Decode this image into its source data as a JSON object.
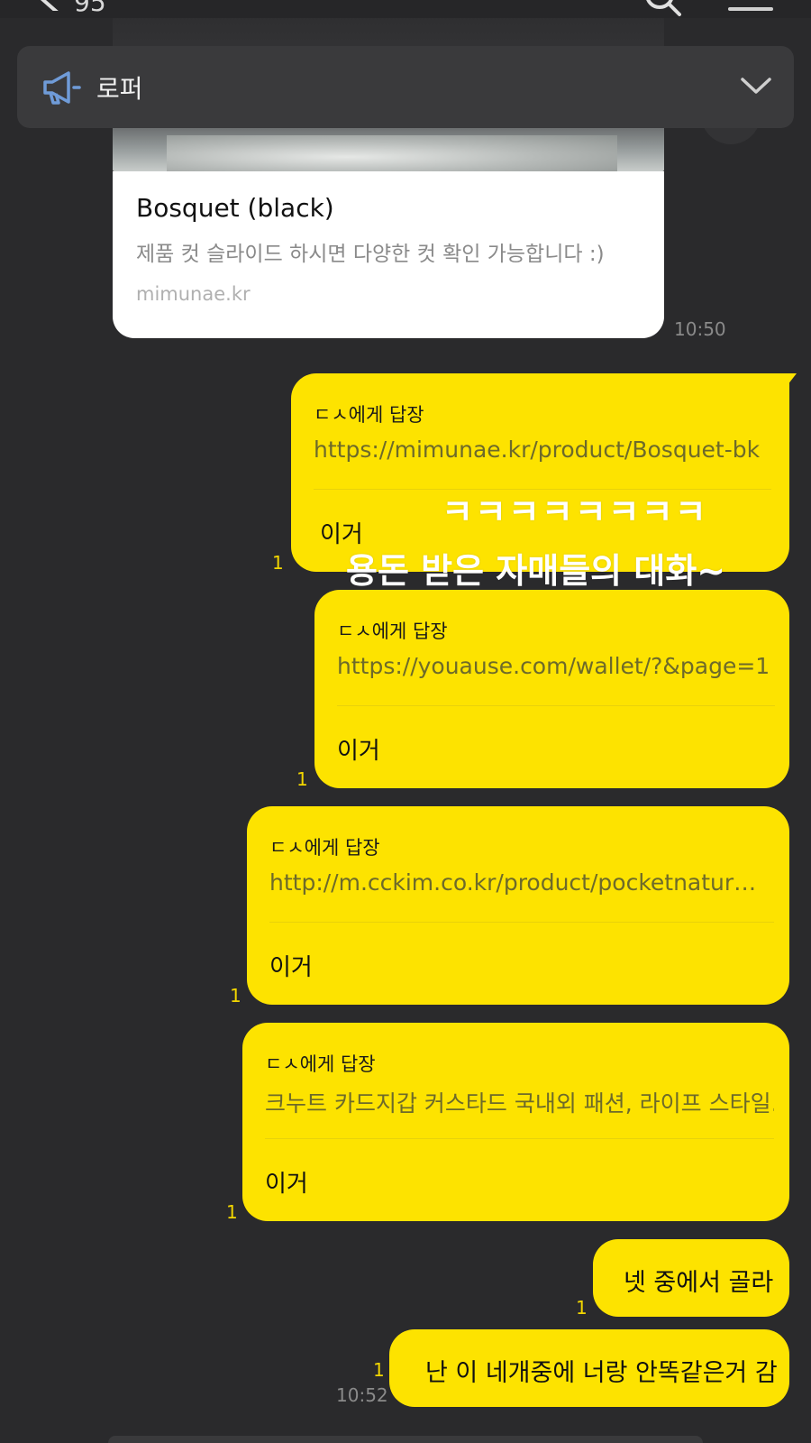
{
  "header": {
    "unread_count": "95"
  },
  "notice": {
    "label": "로퍼"
  },
  "link_card": {
    "title": "Bosquet (black)",
    "description": "제품 컷 슬라이드 하시면 다양한 컷 확인 가능합니다 :)",
    "domain": "mimunae.kr",
    "time": "10:50"
  },
  "messages": [
    {
      "reply_to": "ㄷㅅ에게 답장",
      "reply_text": "https://mimunae.kr/product/Bosquet-bk",
      "body": "이거",
      "unread": "1"
    },
    {
      "reply_to": "ㄷㅅ에게 답장",
      "reply_text": "https://youause.com/wallet/?&page=1",
      "body": "이거",
      "unread": "1"
    },
    {
      "reply_to": "ㄷㅅ에게 답장",
      "reply_text": "http://m.cckim.co.kr/product/pocketnatur…",
      "body": "이거",
      "unread": "1"
    },
    {
      "reply_to": "ㄷㅅ에게 답장",
      "reply_text": "크누트 카드지갑 커스타드 국내외 패션, 라이프 스타일…",
      "body": "이거",
      "unread": "1"
    },
    {
      "body": "넷 중에서 골라",
      "unread": "1"
    },
    {
      "body": "난 이 네개중에 너랑 안똑같은거 감",
      "unread": "1",
      "time": "10:52"
    }
  ],
  "overlay_caption": {
    "line1": "ㅋㅋㅋㅋㅋㅋㅋㅋ",
    "line2": "용돈 받은 자매들의 대화~"
  },
  "colors": {
    "bubble": "#fde300",
    "background": "#2a2a2c",
    "unread": "#f2d600"
  }
}
